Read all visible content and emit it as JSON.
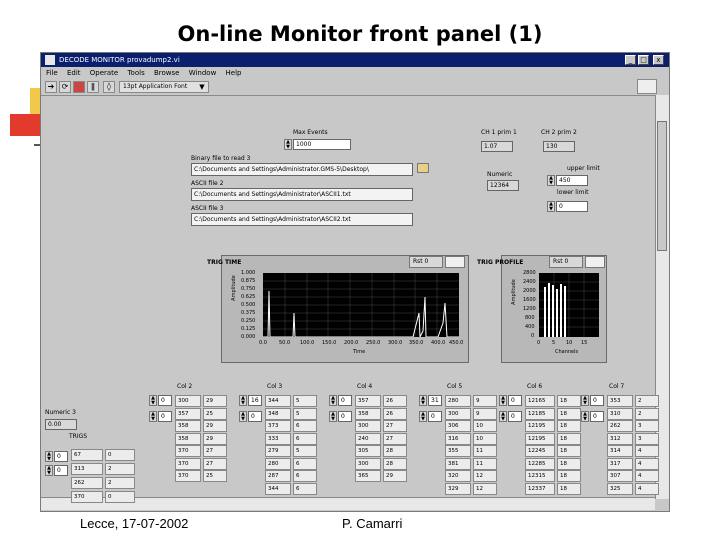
{
  "slide": {
    "title": "On-line Monitor front panel (1)",
    "footer_left": "Lecce, 17-07-2002",
    "footer_right": "P. Camarri"
  },
  "window": {
    "title": "DECODE MONITOR provadump2.vi",
    "buttons": [
      "_",
      "□",
      "x"
    ]
  },
  "menu": [
    "File",
    "Edit",
    "Operate",
    "Tools",
    "Browse",
    "Window",
    "Help"
  ],
  "toolbar": {
    "font": "13pt Application Font",
    "icons": [
      "run-arrow-icon",
      "run-continuous-icon",
      "abort-icon",
      "pause-icon"
    ]
  },
  "controls": {
    "max_events": {
      "label": "Max Events",
      "value": "1000"
    },
    "ch1_prim1": {
      "label": "CH 1 prim 1",
      "value": "1.07"
    },
    "ch2_prim2": {
      "label": "CH 2 prim 2",
      "value": "130"
    },
    "binary_file": {
      "label": "Binary file to read 3",
      "value": "C:\\Documents and Settings\\Administrator.GMS-5\\Desktop\\"
    },
    "ascii_file2": {
      "label": "ASCII file 2",
      "value": "C:\\Documents and Settings\\Administrator\\ASCII1.txt"
    },
    "ascii_file3": {
      "label": "ASCII file 3",
      "value": "C:\\Documents and Settings\\Administrator\\ASCII2.txt"
    },
    "numeric": {
      "label": "Numeric",
      "value": "12364"
    },
    "upper_limit": {
      "label": "upper limit",
      "value": "450"
    },
    "lower_limit": {
      "label": "lower limit",
      "value": "0"
    }
  },
  "plots": {
    "trig_time": {
      "title": "TRIG TIME",
      "mode": "Rst 0",
      "ylabel": "Amplitude",
      "xlabel": "Time",
      "yticks": [
        "1.000",
        "0.875",
        "0.750",
        "0.625",
        "0.500",
        "0.375",
        "0.250",
        "0.125",
        "0.000"
      ],
      "xticks": [
        "0.0",
        "50.0",
        "100.0",
        "150.0",
        "200.0",
        "250.0",
        "300.0",
        "350.0",
        "400.0",
        "450.0"
      ]
    },
    "trig_profile": {
      "title": "TRIG PROFILE",
      "mode": "Rst 0",
      "ylabel": "Amplitude",
      "xlabel": "Channels",
      "yticks": [
        "2800",
        "2400",
        "2000",
        "1600",
        "1200",
        "800",
        "400",
        "0"
      ],
      "xticks": [
        "0",
        "5",
        "10",
        "15"
      ]
    }
  },
  "numeric_left": {
    "label": "Numeric 3",
    "value": "0.00"
  },
  "trigs": {
    "label": "TRIGS",
    "index_values": [
      "0",
      "0"
    ],
    "rows": [
      [
        "67",
        "0"
      ],
      [
        "313",
        "2"
      ],
      [
        "262",
        "2"
      ],
      [
        "370",
        "0"
      ]
    ]
  },
  "column_groups": [
    {
      "label": "Col 2",
      "index": [
        "0",
        "0"
      ],
      "rows": [
        [
          "300",
          "29"
        ],
        [
          "357",
          "25"
        ],
        [
          "358",
          "29"
        ],
        [
          "358",
          "29"
        ],
        [
          "370",
          "27"
        ],
        [
          "370",
          "27"
        ],
        [
          "370",
          "25"
        ]
      ]
    },
    {
      "label": "Col 3",
      "index": [
        "16",
        "0"
      ],
      "rows": [
        [
          "344",
          "5"
        ],
        [
          "348",
          "5"
        ],
        [
          "373",
          "6"
        ],
        [
          "333",
          "6"
        ],
        [
          "279",
          "5"
        ],
        [
          "280",
          "6"
        ],
        [
          "287",
          "6"
        ],
        [
          "344",
          "6"
        ]
      ]
    },
    {
      "label": "Col 4",
      "index": [
        "0",
        "0"
      ],
      "rows": [
        [
          "357",
          "26"
        ],
        [
          "358",
          "26"
        ],
        [
          "300",
          "27"
        ],
        [
          "240",
          "27"
        ],
        [
          "305",
          "28"
        ],
        [
          "300",
          "28"
        ],
        [
          "365",
          "29"
        ]
      ]
    },
    {
      "label": "Col 5",
      "index": [
        "31",
        "0"
      ],
      "rows": [
        [
          "280",
          "9"
        ],
        [
          "300",
          "9"
        ],
        [
          "306",
          "10"
        ],
        [
          "316",
          "10"
        ],
        [
          "355",
          "11"
        ],
        [
          "381",
          "11"
        ],
        [
          "320",
          "12"
        ],
        [
          "329",
          "12"
        ]
      ]
    },
    {
      "label": "Col 6",
      "index": [
        "0",
        "0"
      ],
      "rows": [
        [
          "12165",
          "18"
        ],
        [
          "12185",
          "18"
        ],
        [
          "12195",
          "18"
        ],
        [
          "12195",
          "18"
        ],
        [
          "12245",
          "18"
        ],
        [
          "12285",
          "18"
        ],
        [
          "12315",
          "18"
        ],
        [
          "12337",
          "18"
        ]
      ]
    },
    {
      "label": "Col 7",
      "index": [
        "0",
        "0"
      ],
      "rows": [
        [
          "353",
          "2"
        ],
        [
          "310",
          "2"
        ],
        [
          "262",
          "3"
        ],
        [
          "312",
          "3"
        ],
        [
          "314",
          "4"
        ],
        [
          "317",
          "4"
        ],
        [
          "307",
          "4"
        ],
        [
          "325",
          "4"
        ]
      ]
    }
  ]
}
